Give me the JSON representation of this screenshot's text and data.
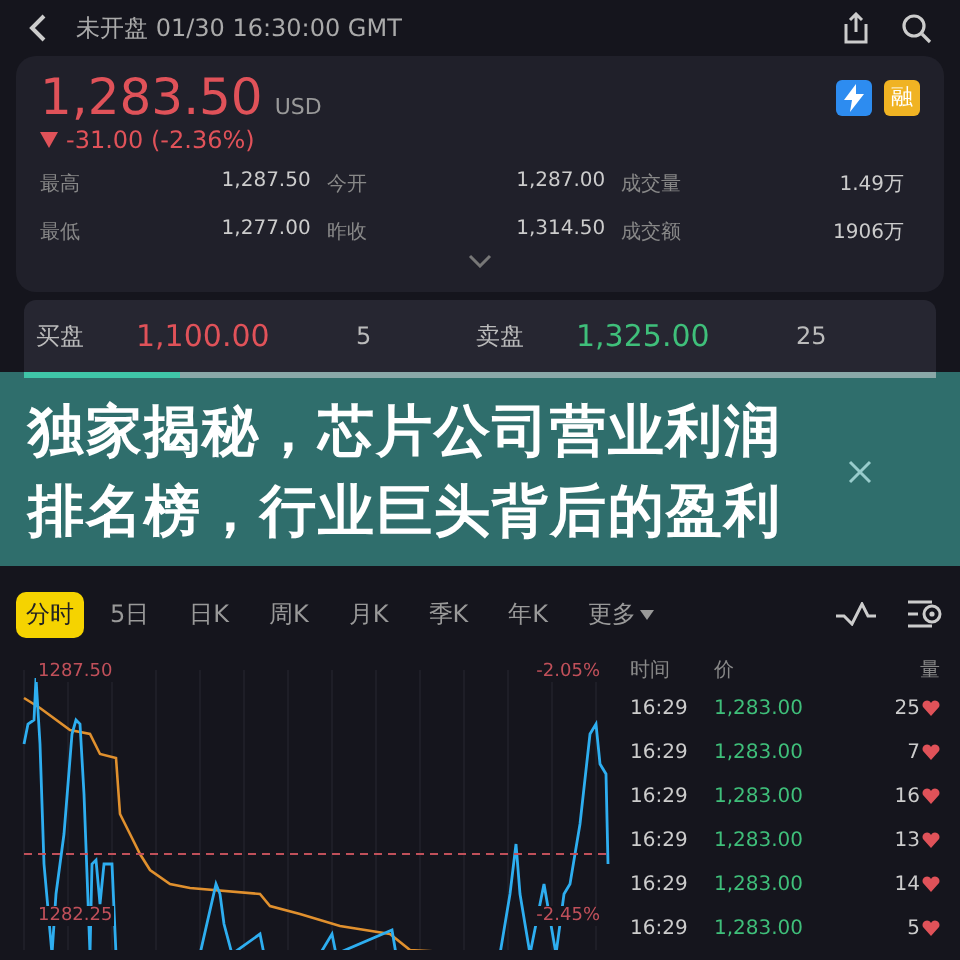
{
  "header": {
    "status": "未开盘",
    "time": "01/30 16:30:00 GMT"
  },
  "quote": {
    "price": "1,283.50",
    "currency": "USD",
    "change": "-31.00 (-2.36%)",
    "badge": "融",
    "stats": [
      {
        "label": "最高",
        "value": "1,287.50"
      },
      {
        "label": "今开",
        "value": "1,287.00"
      },
      {
        "label": "成交量",
        "value": "1.49万"
      },
      {
        "label": "最低",
        "value": "1,277.00"
      },
      {
        "label": "昨收",
        "value": "1,314.50"
      },
      {
        "label": "成交额",
        "value": "1906万"
      }
    ]
  },
  "order_book": {
    "bid_label": "买盘",
    "bid_price": "1,100.00",
    "bid_size": "5",
    "ask_label": "卖盘",
    "ask_price": "1,325.00",
    "ask_size": "25",
    "level": 0.17
  },
  "banner": {
    "title": "独家揭秘，芯片公司营业利润排名榜，行业巨头背后的盈利"
  },
  "periods": [
    {
      "label": "分时",
      "selected": true
    },
    {
      "label": "5日",
      "selected": false
    },
    {
      "label": "日K",
      "selected": false
    },
    {
      "label": "周K",
      "selected": false
    },
    {
      "label": "月K",
      "selected": false
    },
    {
      "label": "季K",
      "selected": false
    },
    {
      "label": "年K",
      "selected": false
    },
    {
      "label": "更多",
      "selected": false
    }
  ],
  "chart": {
    "high": "1287.50",
    "high_pct": "-2.05%",
    "mid": "1282.25",
    "mid_pct": "-2.45%"
  },
  "trades": {
    "columns": [
      "时间",
      "价",
      "量"
    ],
    "rows": [
      {
        "time": "16:29",
        "price": "1,283.00",
        "qty": "25"
      },
      {
        "time": "16:29",
        "price": "1,283.00",
        "qty": "7"
      },
      {
        "time": "16:29",
        "price": "1,283.00",
        "qty": "16"
      },
      {
        "time": "16:29",
        "price": "1,283.00",
        "qty": "13"
      },
      {
        "time": "16:29",
        "price": "1,283.00",
        "qty": "14"
      },
      {
        "time": "16:29",
        "price": "1,283.00",
        "qty": "5"
      }
    ]
  }
}
